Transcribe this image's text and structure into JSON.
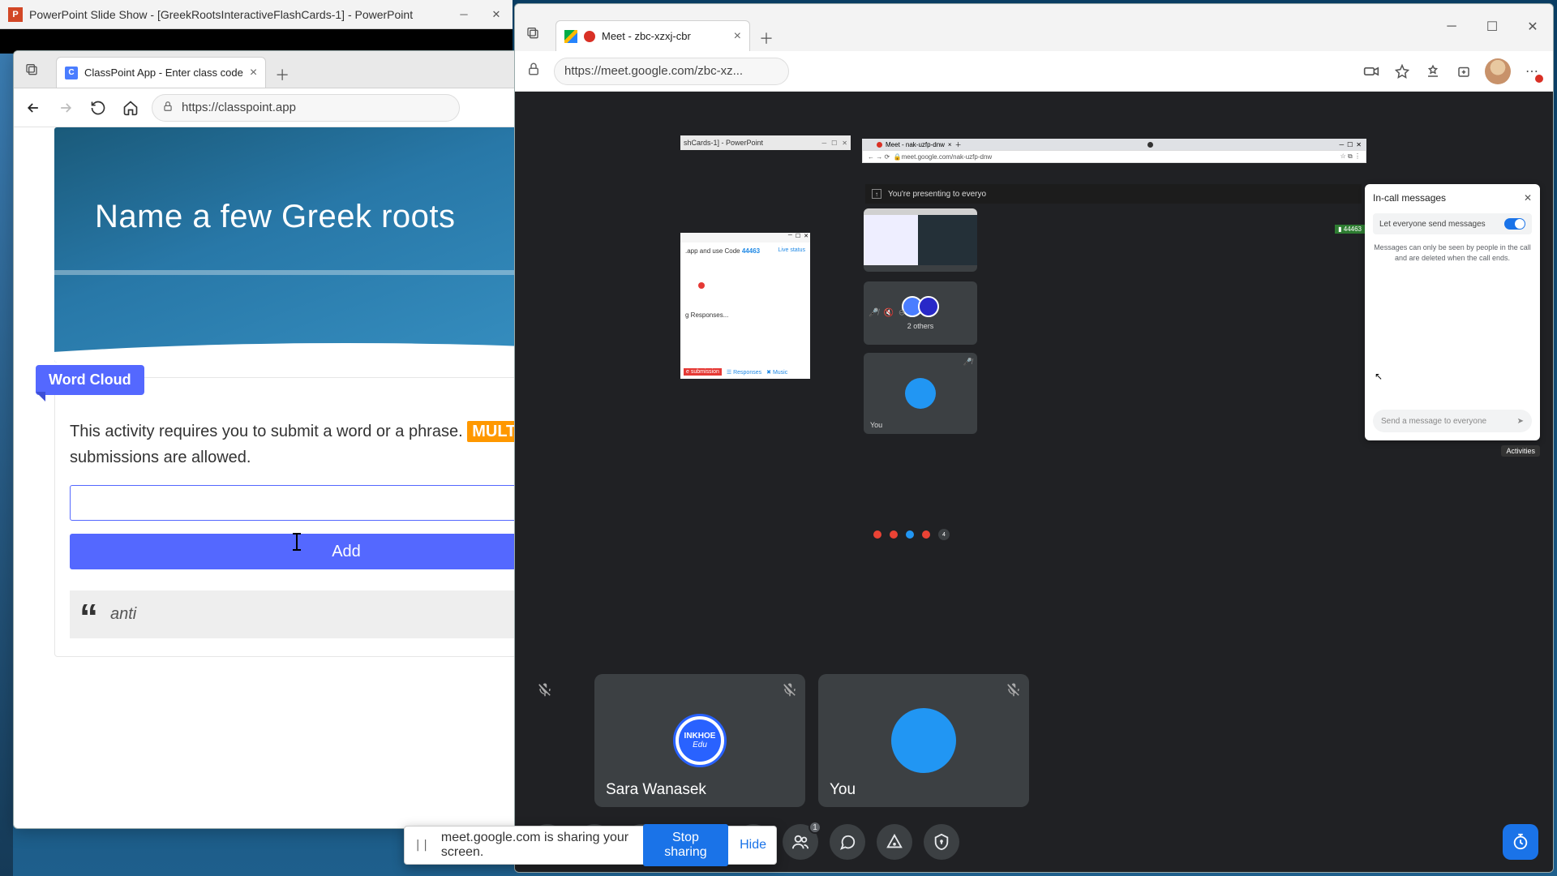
{
  "powerpoint": {
    "title": "PowerPoint Slide Show - [GreekRootsInteractiveFlashCards-1] - PowerPoint",
    "icon_letter": "P"
  },
  "edge_left": {
    "tab": {
      "favicon_letter": "C",
      "title": "ClassPoint App - Enter class code"
    },
    "url": "https://classpoint.app",
    "slide_question": "Name a few Greek roots",
    "word_cloud_label": "Word Cloud",
    "instruction_pre": "This activity requires you to submit a word or a phrase. ",
    "instruction_pill": "MULTIPLE",
    "instruction_post": " submissions are allowed.",
    "input_value": "",
    "add_label": "Add",
    "quote": "anti"
  },
  "edge_right": {
    "tab_title": "Meet - zbc-xzxj-cbr",
    "url": "https://meet.google.com/zbc-xz...",
    "share_mock": {
      "ppt_title": "shCards-1] - PowerPoint",
      "chrome_tab": "Meet - nak-uzfp-dnw",
      "chrome_url": "meet.google.com/nak-uzfp-dnw",
      "present_banner": "You're presenting to everyo",
      "code_badge": "44463",
      "classpoint": {
        "line1_pre": ".app and use Code ",
        "code": "44463",
        "live": "Live status",
        "responses": "g Responses...",
        "submit": "e submission",
        "resp_btn": "Responses",
        "music_btn": "Music"
      },
      "two_others": "2 others",
      "you": "You",
      "chat": {
        "title": "In-call messages",
        "toggle_label": "Let everyone send messages",
        "note": "Messages can only be seen by people in the call and are deleted when the call ends.",
        "placeholder": "Send a message to everyone"
      },
      "activities_tip": "Activities",
      "people_badge": "4"
    },
    "tiles": {
      "sara": "Sara Wanasek",
      "ink_top": "INKHOE",
      "ink_bottom": "Edu",
      "you": "You"
    },
    "bar": {
      "people_badge": "1"
    }
  },
  "share_banner": {
    "text": "meet.google.com is sharing your screen.",
    "stop": "Stop sharing",
    "hide": "Hide"
  }
}
